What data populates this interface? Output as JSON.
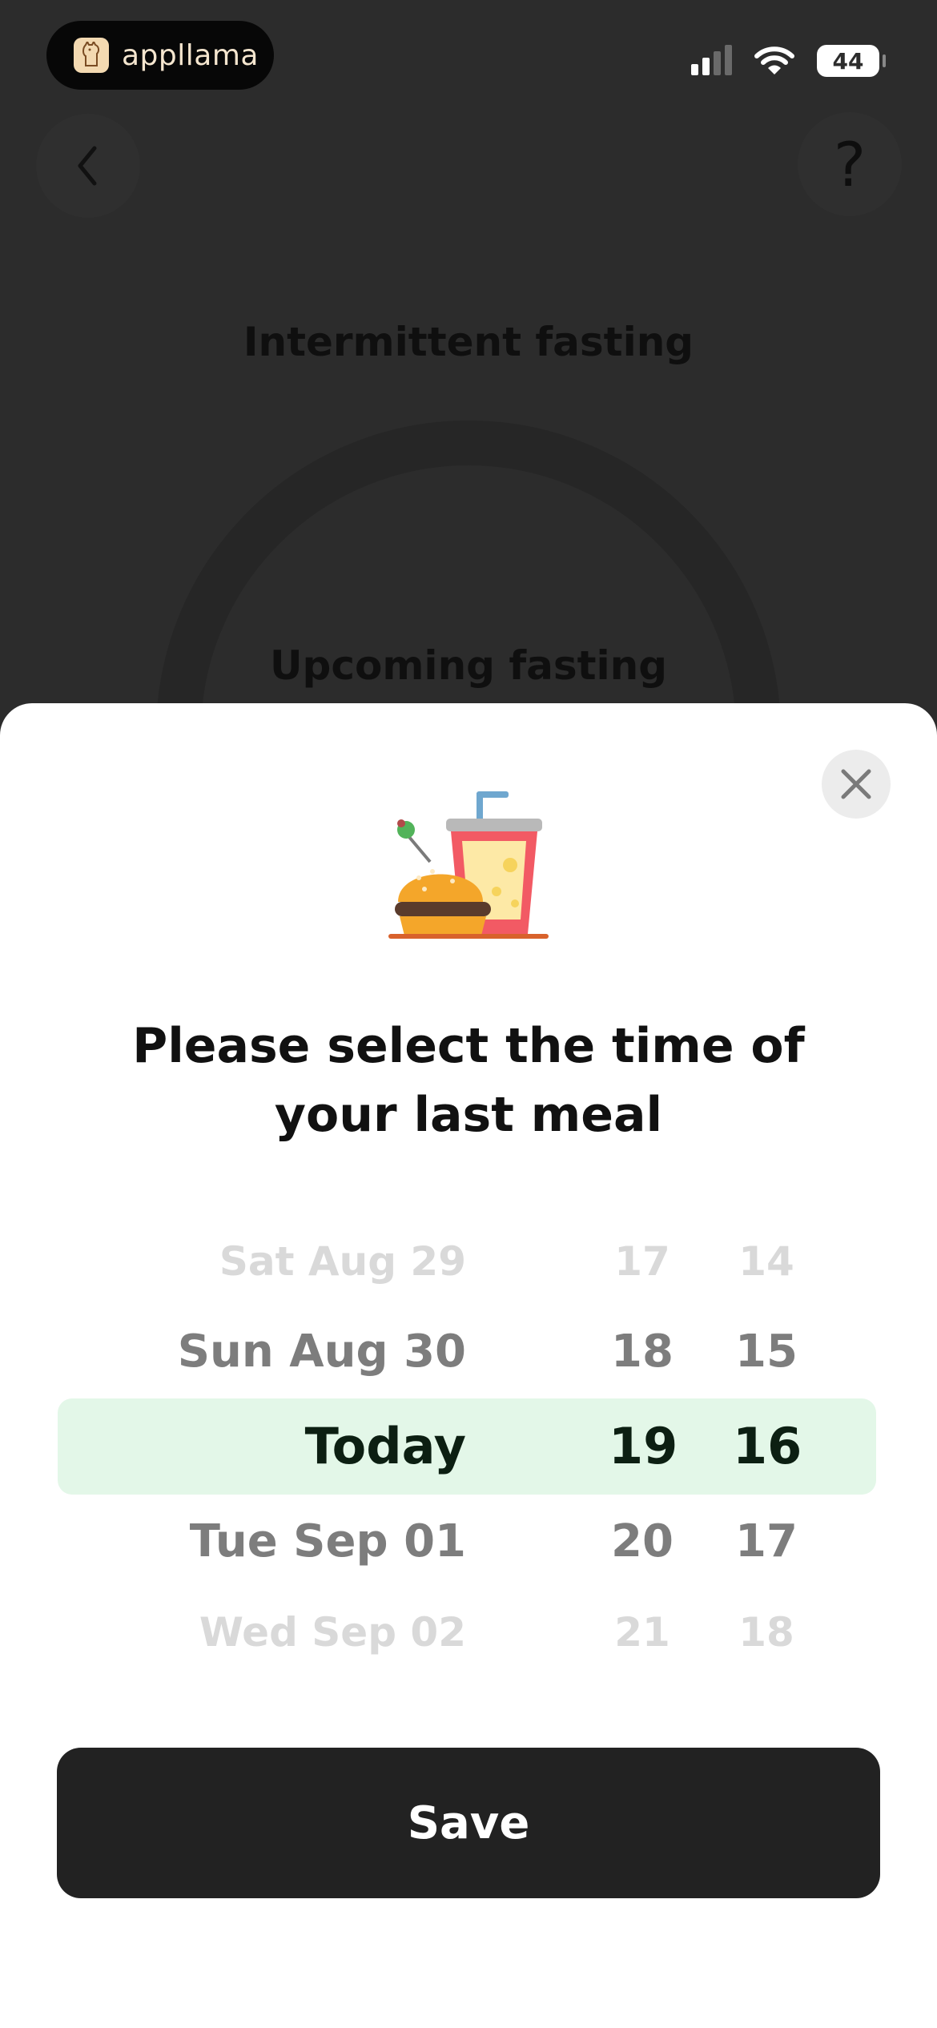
{
  "status_bar": {
    "brand_name": "appllama",
    "battery_level": "44",
    "signal_bars_active": 2,
    "signal_bars_total": 4
  },
  "background": {
    "title": "Intermittent fasting",
    "subtitle": "Upcoming fasting",
    "help_label": "?"
  },
  "sheet": {
    "heading": "Please select the time of your last meal",
    "picker": {
      "dates": [
        "Sat Aug 29",
        "Sun Aug 30",
        "Today",
        "Tue Sep 01",
        "Wed Sep 02"
      ],
      "hours": [
        "17",
        "18",
        "19",
        "20",
        "21"
      ],
      "minutes": [
        "14",
        "15",
        "16",
        "17",
        "18"
      ],
      "selected_index": 2,
      "highlight_color": "#e3f7e8"
    },
    "save_label": "Save"
  }
}
